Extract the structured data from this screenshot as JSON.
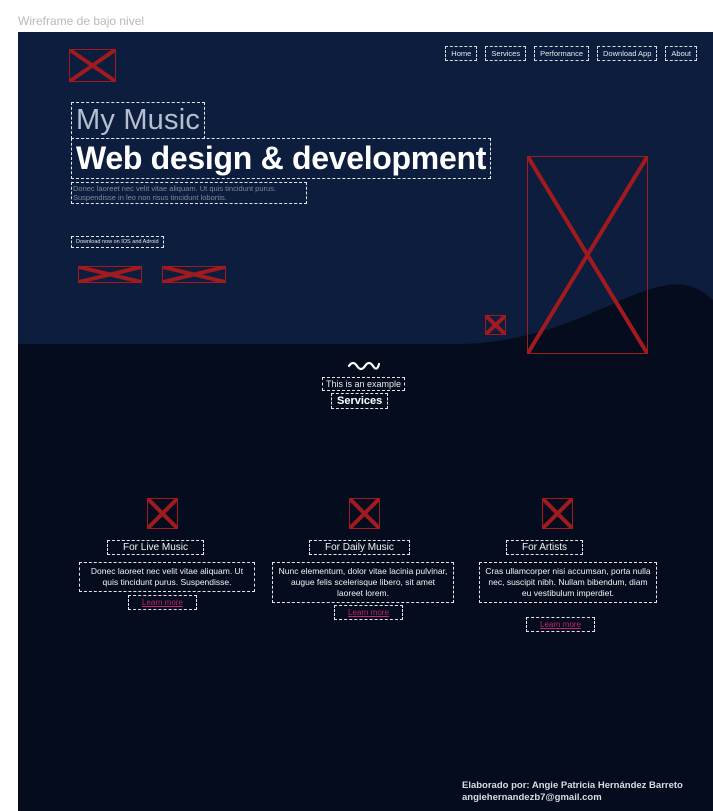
{
  "frame": {
    "label": "Wireframe de bajo nivel"
  },
  "nav": {
    "items": [
      "Home",
      "Services",
      "Performance",
      "Download App",
      "About"
    ]
  },
  "hero": {
    "kicker": "My Music",
    "title": "Web design & development",
    "description": "Donec laoreet nec velit vitae aliquam. Ut quis tincidunt purus. Suspendisse in leo non risus tincidunt lobortis.",
    "cta": "Download now on IOS and Adroid"
  },
  "services": {
    "kicker": "This is an example",
    "title": "Services",
    "cards": [
      {
        "title": "For Live Music",
        "text": "Donec laoreet nec velit vitae aliquam. Ut quis tincidunt purus. Suspendisse.",
        "link": "Learn more"
      },
      {
        "title": "For Daily Music",
        "text": "Nunc elementum, dolor vitae lacinia pulvinar, augue felis scelerisque libero, sit amet laoreet lorem.",
        "link": "Learn more"
      },
      {
        "title": "For Artists",
        "text": "Cras ullamcorper nisi accumsan, porta nulla nec, suscipit nibh. Nullam bibendum, diam eu vestibulum imperdiet.",
        "link": "Learn more"
      }
    ]
  },
  "footer": {
    "credit_line1": "Elaborado por: Angie Patricia Hernández Barreto",
    "credit_line2": "angiehernandezb7@gmail.com"
  },
  "colors": {
    "background": "#050c1d",
    "hero_panel": "#0d1d3d",
    "placeholder_red": "#a01a1e",
    "link_pink": "#c0246c"
  },
  "icons": {
    "placeholder": "image-placeholder-icon",
    "wave": "wave-icon"
  }
}
